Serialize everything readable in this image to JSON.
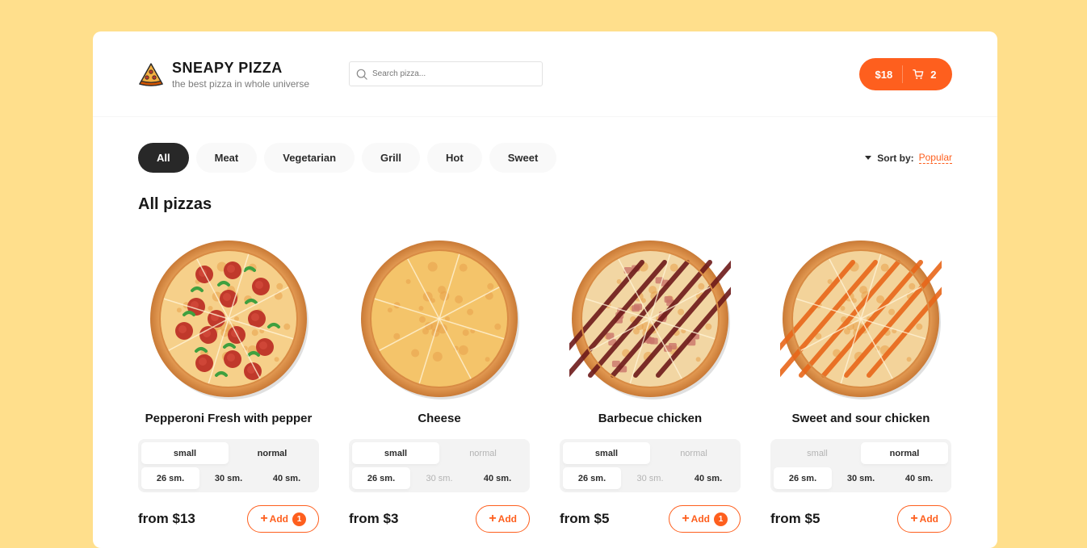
{
  "header": {
    "logo_title": "SNEAPY PIZZA",
    "logo_subtitle": "the best pizza in whole universe",
    "search_placeholder": "Search pizza...",
    "cart_total": "$18",
    "cart_count": "2"
  },
  "categories": [
    "All",
    "Meat",
    "Vegetarian",
    "Grill",
    "Hot",
    "Sweet"
  ],
  "active_category": "All",
  "sort": {
    "label": "Sort by:",
    "value": "Popular"
  },
  "section_title": "All pizzas",
  "colors": {
    "accent": "#fe5f1e",
    "background": "#ffdf8c",
    "dark": "#282828"
  },
  "pizzas": [
    {
      "name": "Pepperoni Fresh with pepper",
      "types": [
        {
          "label": "small",
          "state": "active"
        },
        {
          "label": "normal",
          "state": "normal"
        }
      ],
      "sizes": [
        {
          "label": "26 sm.",
          "state": "active"
        },
        {
          "label": "30 sm.",
          "state": "normal"
        },
        {
          "label": "40 sm.",
          "state": "normal"
        }
      ],
      "price": "from $13",
      "add_label": "Add",
      "count": "1",
      "style": "pepperoni"
    },
    {
      "name": "Cheese",
      "types": [
        {
          "label": "small",
          "state": "active"
        },
        {
          "label": "normal",
          "state": "disabled"
        }
      ],
      "sizes": [
        {
          "label": "26 sm.",
          "state": "active"
        },
        {
          "label": "30 sm.",
          "state": "disabled"
        },
        {
          "label": "40 sm.",
          "state": "normal"
        }
      ],
      "price": "from $3",
      "add_label": "Add",
      "count": "",
      "style": "cheese"
    },
    {
      "name": "Barbecue chicken",
      "types": [
        {
          "label": "small",
          "state": "active"
        },
        {
          "label": "normal",
          "state": "disabled"
        }
      ],
      "sizes": [
        {
          "label": "26 sm.",
          "state": "active"
        },
        {
          "label": "30 sm.",
          "state": "disabled"
        },
        {
          "label": "40 sm.",
          "state": "normal"
        }
      ],
      "price": "from $5",
      "add_label": "Add",
      "count": "1",
      "style": "bbq"
    },
    {
      "name": "Sweet and sour chicken",
      "types": [
        {
          "label": "small",
          "state": "disabled"
        },
        {
          "label": "normal",
          "state": "active"
        }
      ],
      "sizes": [
        {
          "label": "26 sm.",
          "state": "active"
        },
        {
          "label": "30 sm.",
          "state": "normal"
        },
        {
          "label": "40 sm.",
          "state": "normal"
        }
      ],
      "price": "from $5",
      "add_label": "Add",
      "count": "",
      "style": "sweet"
    }
  ]
}
